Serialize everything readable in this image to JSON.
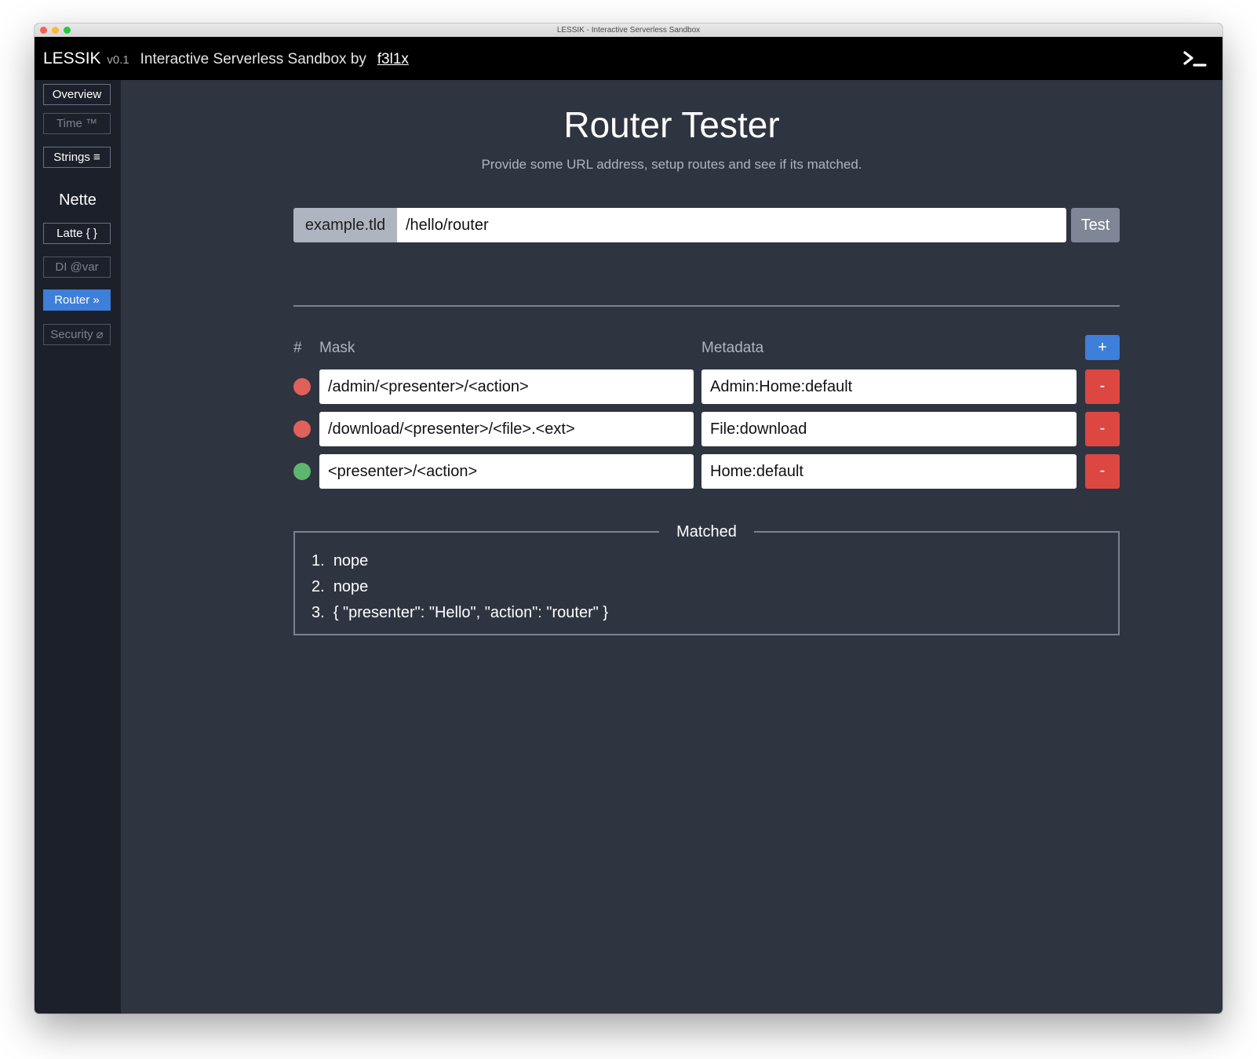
{
  "window": {
    "title": "LESSIK - Interactive Serverless Sandbox"
  },
  "header": {
    "app_name": "LESSIK",
    "version": "v0.1",
    "tagline": "Interactive Serverless Sandbox by",
    "author": "f3l1x",
    "terminal_icon": "terminal-prompt-icon"
  },
  "sidebar": {
    "items": [
      {
        "label": "Overview",
        "state": "enabled"
      },
      {
        "label": "Time ™",
        "state": "disabled"
      },
      {
        "label": "Strings ≡",
        "state": "enabled"
      }
    ],
    "section_title": "Nette",
    "section_items": [
      {
        "label": "Latte { }",
        "state": "enabled"
      },
      {
        "label": "DI @var",
        "state": "disabled"
      },
      {
        "label": "Router »",
        "state": "active"
      },
      {
        "label": "Security ⌀",
        "state": "disabled"
      }
    ]
  },
  "main": {
    "title": "Router Tester",
    "subtitle": "Provide some URL address, setup routes and see if its matched.",
    "url": {
      "prefix": "example.tld",
      "value": "/hello/router",
      "test_label": "Test"
    },
    "routes": {
      "headers": {
        "hash": "#",
        "mask": "Mask",
        "metadata": "Metadata"
      },
      "add_label": "+",
      "remove_label": "-",
      "rows": [
        {
          "mask": "/admin/<presenter>/<action>",
          "metadata": "Admin:Home:default",
          "matched": false
        },
        {
          "mask": "/download/<presenter>/<file>.<ext>",
          "metadata": "File:download",
          "matched": false
        },
        {
          "mask": "<presenter>/<action>",
          "metadata": "Home:default",
          "matched": true
        }
      ]
    },
    "matched": {
      "legend": "Matched",
      "results": [
        {
          "num": "1.",
          "text": "nope"
        },
        {
          "num": "2.",
          "text": "nope"
        },
        {
          "num": "3.",
          "text": "{ \"presenter\": \"Hello\", \"action\": \"router\" }"
        }
      ]
    }
  },
  "colors": {
    "window_bg": "#2f3441",
    "sidebar_bg": "#1c202b",
    "header_bg": "#000000",
    "accent": "#3d7fd9",
    "danger": "#dc4742",
    "status_no_match": "#e0605c",
    "status_match": "#5eb66e"
  }
}
